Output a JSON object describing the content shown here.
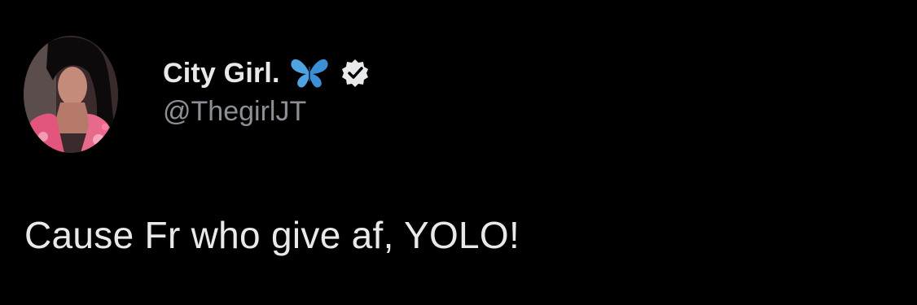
{
  "author": {
    "display_name": "City Girl.",
    "handle": "@ThegirlJT",
    "name_emoji": "butterfly-icon",
    "verified_badge": "verified-badge-icon"
  },
  "tweet": {
    "text": "Cause Fr who give af, YOLO!"
  },
  "colors": {
    "background": "#000000",
    "primary_text": "#e7e9ea",
    "secondary_text": "#8b9096",
    "butterfly": "#4fa3e0"
  }
}
